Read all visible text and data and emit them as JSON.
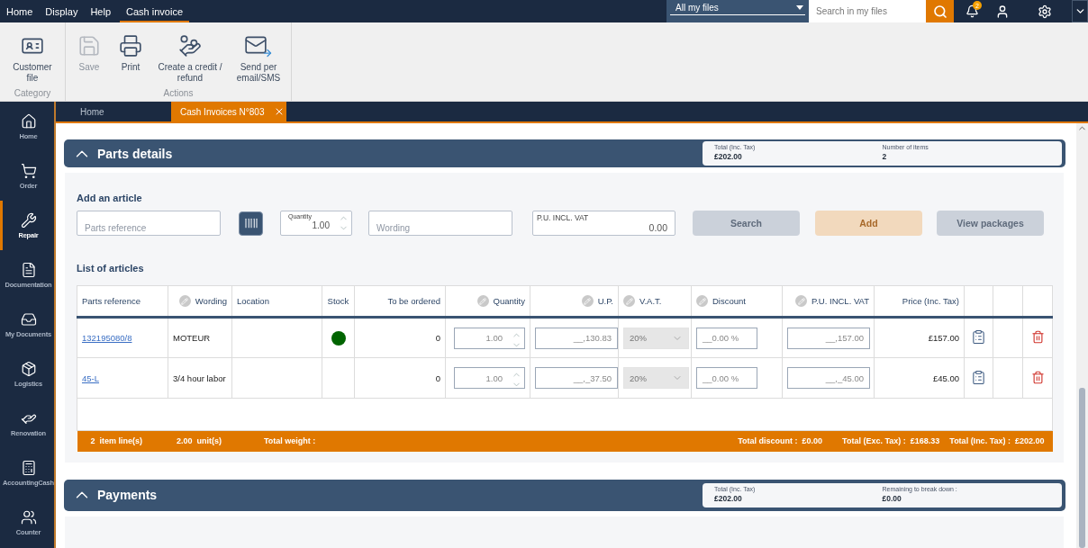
{
  "menu": [
    {
      "label": "Home",
      "selected": false
    },
    {
      "label": "Display",
      "selected": false
    },
    {
      "label": "Help",
      "selected": false
    },
    {
      "label": "Cash invoice",
      "selected": true
    }
  ],
  "topbar": {
    "scope": "All my files",
    "search_placeholder": "Search in my files",
    "notifications": "2"
  },
  "ribbon": [
    {
      "label": "Category",
      "items": [
        {
          "label": "Customer file",
          "disabled": false
        }
      ]
    },
    {
      "label": "Actions",
      "items": [
        {
          "label": "Save",
          "disabled": true
        },
        {
          "label": "Print",
          "disabled": false
        },
        {
          "label": "Create a credit / refund",
          "disabled": false
        },
        {
          "label": "Send per email/SMS",
          "disabled": false
        }
      ]
    }
  ],
  "doc_tabs": [
    {
      "label": "Home",
      "selected": false,
      "closable": false
    },
    {
      "label": "Cash Invoices N°803",
      "selected": true,
      "closable": true
    }
  ],
  "sidebar": [
    {
      "label": "Home",
      "selected": false
    },
    {
      "label": "Order",
      "selected": false
    },
    {
      "label": "Repair",
      "selected": true
    },
    {
      "label": "Documentation",
      "selected": false
    },
    {
      "label": "My Documents",
      "selected": false
    },
    {
      "label": "Logistics",
      "selected": false
    },
    {
      "label": "Renovation",
      "selected": false
    },
    {
      "label": "AccountingCash",
      "selected": false
    },
    {
      "label": "Counter",
      "selected": false
    }
  ],
  "parts_details": {
    "title": "Parts details",
    "expanded": true,
    "summary": [
      {
        "label": "Total (Inc. Tax)",
        "value": "£202.00"
      },
      {
        "label": "Number of items",
        "value": "2"
      }
    ],
    "add_article": {
      "title": "Add an article",
      "reference_placeholder": "Parts reference",
      "quantity": {
        "label": "Quantity",
        "value": "1.00"
      },
      "wording_placeholder": "Wording",
      "unit_price": {
        "label": "P.U. INCL. VAT",
        "value": "0.00"
      },
      "buttons": [
        {
          "label": "Search",
          "kind": "secondary",
          "disabled": true
        },
        {
          "label": "Add",
          "kind": "primary",
          "disabled": true
        },
        {
          "label": "View packages",
          "kind": "secondary",
          "disabled": true
        }
      ]
    },
    "list_title": "List of articles",
    "columns": [
      {
        "label": "Parts reference",
        "editable": false
      },
      {
        "label": "Wording",
        "editable": true
      },
      {
        "label": "Location",
        "editable": false
      },
      {
        "label": "Stock",
        "editable": false
      },
      {
        "label": "To be ordered",
        "editable": false
      },
      {
        "label": "Quantity",
        "editable": true
      },
      {
        "label": "U.P.",
        "editable": true
      },
      {
        "label": "V.A.T.",
        "editable": true
      },
      {
        "label": "Discount",
        "editable": true
      },
      {
        "label": "P.U. INCL. VAT",
        "editable": true
      },
      {
        "label": "Price (Inc. Tax)",
        "editable": false
      }
    ],
    "rows": [
      {
        "reference": "132195080/8",
        "wording": "MOTEUR",
        "stock": {
          "color": "#006400"
        },
        "to_order": "0",
        "quantity": "1.00",
        "unit_price": "__,130.83",
        "vat": "20%",
        "discount": "__0.00 %",
        "price_incl_vat": "__,157.00",
        "price": "£157.00"
      },
      {
        "reference": "45-L",
        "wording": "3/4 hour labor",
        "to_order": "0",
        "quantity": "1.00",
        "unit_price": "__,_37.50",
        "vat": "20%",
        "discount": "__0.00 %",
        "price_incl_vat": "__,_45.00",
        "price": "£45.00"
      }
    ],
    "footer_left": [
      "2  item line(s)",
      "2.00  unit(s)",
      "Total weight :"
    ],
    "footer_right": [
      "Total discount :  £0.00",
      "Total (Exc. Tax) :  £168.33",
      "Total (Inc. Tax) :  £202.00"
    ]
  },
  "payments": {
    "title": "Payments",
    "expanded": true,
    "summary": [
      {
        "label": "Total (Inc. Tax)",
        "value": "£202.00"
      },
      {
        "label": "Remaining to break down :",
        "value": "£0.00"
      }
    ]
  }
}
